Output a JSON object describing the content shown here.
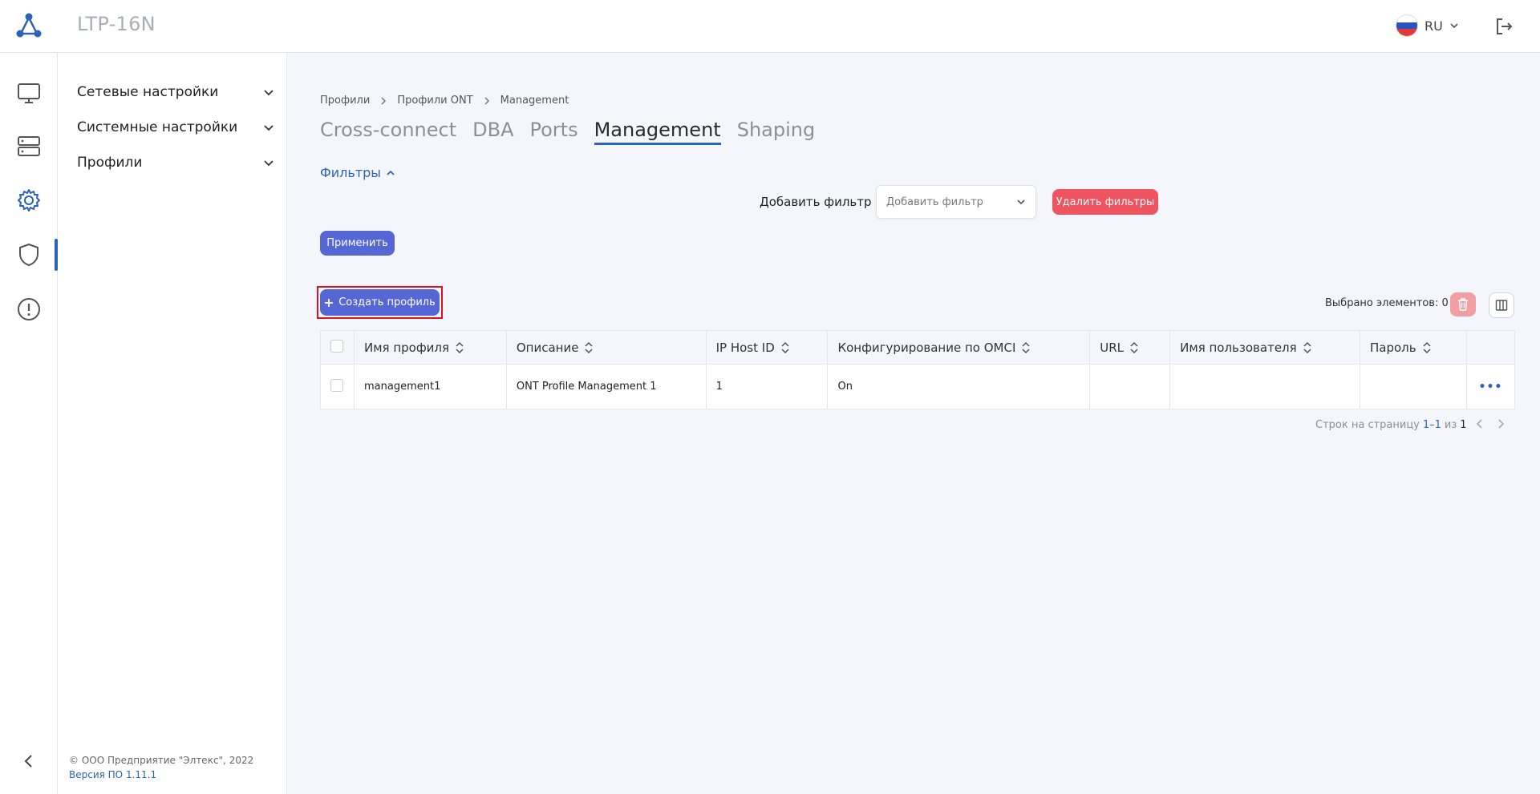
{
  "header": {
    "device": "LTP-16N",
    "lang": "RU"
  },
  "side_menu": [
    {
      "label": "Сетевые настройки"
    },
    {
      "label": "Системные настройки"
    },
    {
      "label": "Профили"
    }
  ],
  "footer": {
    "copyright": "© ООО Предприятие \"Элтекс\", 2022",
    "version": "Версия ПО 1.11.1"
  },
  "breadcrumbs": [
    "Профили",
    "Профили ONT",
    "Management"
  ],
  "tabs": [
    "Cross-connect",
    "DBA",
    "Ports",
    "Management",
    "Shaping"
  ],
  "active_tab": "Management",
  "filters": {
    "toggle_label": "Фильтры",
    "add_label": "Добавить фильтр",
    "select_placeholder": "Добавить фильтр",
    "clear_label": "Удалить фильтры",
    "apply_label": "Применить"
  },
  "actions": {
    "create_label": "Создать профиль",
    "selected_label": "Выбрано элементов: 0"
  },
  "table": {
    "columns": [
      "Имя профиля",
      "Описание",
      "IP Host ID",
      "Конфигурирование по OMCI",
      "URL",
      "Имя пользователя",
      "Пароль"
    ],
    "rows": [
      {
        "name": "management1",
        "description": "ONT Profile Management 1",
        "ip_host_id": "1",
        "omci": "On",
        "url": "",
        "username": "",
        "password": ""
      }
    ],
    "row_menu": "•••"
  },
  "pagination": {
    "label": "Строк на страницу",
    "range": "1–1",
    "of": "из",
    "total": "1"
  },
  "colors": {
    "accent": "#2c63b8",
    "primary_button": "#5467d4",
    "danger": "#ee5561",
    "highlight_box": "#d9121f"
  }
}
